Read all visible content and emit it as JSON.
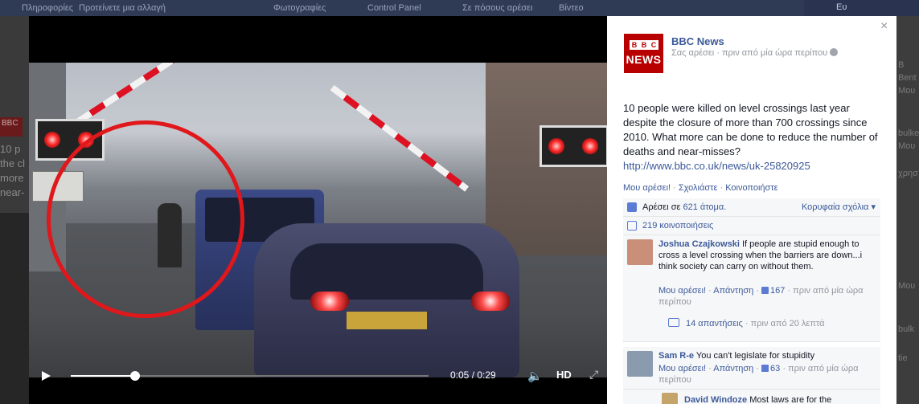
{
  "background": {
    "top_tabs": [
      "Πληροφορίες",
      "Προτείνετε μια αλλαγή",
      "Φωτογραφίες",
      "Control Panel",
      "Σε πόσους αρέσει",
      "Βίντεο"
    ],
    "right_top_name": "Ευ",
    "left_fragments": [
      "10 p",
      "the cl",
      "more",
      "near-"
    ],
    "left_badge": "BBC",
    "right_fragments": [
      "B",
      "Bent",
      "Μου",
      "bulke",
      "Μου",
      "χρησ",
      "Μου",
      "bulk",
      "tie"
    ]
  },
  "video": {
    "progress_fraction": 0.18,
    "time_display": "0:05 / 0:29",
    "hd_label": "HD"
  },
  "panel": {
    "close_glyph": "×",
    "logo_blocks": [
      "B",
      "B",
      "C"
    ],
    "logo_text": "NEWS",
    "page_name": "BBC News",
    "meta": "Σας αρέσει · πριν από μία ώρα περίπου",
    "post_text": "10 people were killed on level crossings last year despite the closure of more than 700 crossings since 2010. What more can be done to reduce the number of deaths and near-misses?",
    "post_link": "http://www.bbc.co.uk/news/uk-25820925",
    "actions": {
      "like": "Μου αρέσει!",
      "comment": "Σχολιάστε",
      "share": "Κοινοποιήστε",
      "separator": "·"
    },
    "likes_prefix": "Αρέσει σε",
    "likes_link": "621 άτομα.",
    "sort_label": "Κορυφαία σχόλια",
    "shares_label": "219 κοινοποιήσεις",
    "comments": [
      {
        "author": "Joshua Czajkowski",
        "text": "If people are stupid enough to cross a level crossing when the barriers are down...i think society can carry on without them.",
        "like": "Μου αρέσει!",
        "reply": "Απάντηση",
        "like_count": "167",
        "time": "πριν από μία ώρα περίπου",
        "replies_label": "14 απαντήσεις",
        "replies_time": "πριν από 20 λεπτά",
        "avatar_color": "#c98f79"
      },
      {
        "author": "Sam R-e",
        "text": "You can't legislate for stupidity",
        "like": "Μου αρέσει!",
        "reply": "Απάντηση",
        "like_count": "63",
        "time": "πριν από μία ώρα περίπου",
        "avatar_color": "#8a9bb0"
      },
      {
        "author": "David Windoze",
        "text": "Most laws are for the",
        "avatar_color": "#c4a468"
      }
    ]
  }
}
